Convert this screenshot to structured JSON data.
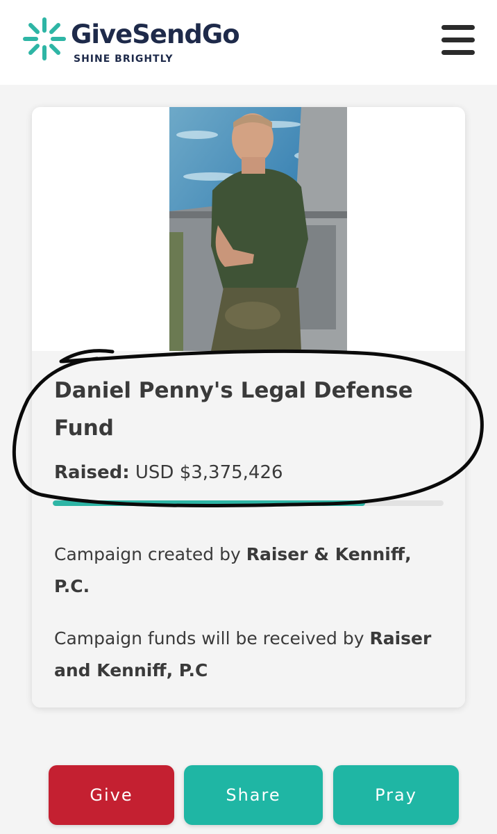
{
  "header": {
    "logo_text": "GiveSendGo",
    "tagline": "SHINE BRIGHTLY",
    "menu_icon": "hamburger-menu-icon"
  },
  "campaign": {
    "photo": "campaign-photo",
    "title": "Daniel Penny's Legal Defense Fund",
    "raised_label": "Raised:",
    "raised_value": "USD $3,375,426",
    "progress_fraction": 0.8,
    "created_prefix": "Campaign created by",
    "created_by": "Raiser & Kenniff, P.C.",
    "received_prefix": "Campaign funds will be received by",
    "received_by": "Raiser and Kenniff, P.C"
  },
  "actions": {
    "give": "Give",
    "share": "Share",
    "pray": "Pray"
  },
  "colors": {
    "brand_navy": "#1e2a4a",
    "brand_teal": "#2eb5a5",
    "give_red": "#c42031",
    "action_teal": "#1fb6a4"
  }
}
